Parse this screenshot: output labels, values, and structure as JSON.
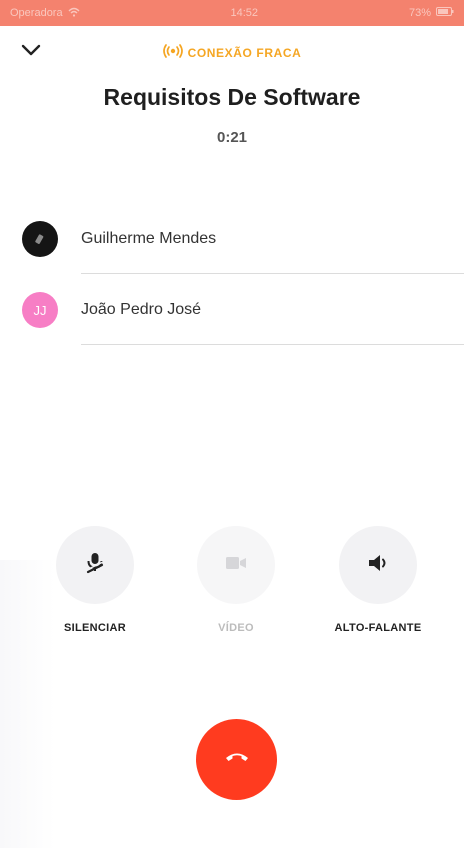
{
  "status_bar": {
    "carrier": "Operadora",
    "time": "14:52",
    "battery": "73%",
    "bg_color": "#f4826e"
  },
  "header": {
    "collapse_icon": "chevron-down-icon",
    "connection_warning": "CONEXÃO FRACA",
    "warning_icon": "broadcast-icon",
    "warning_color": "#f5a623"
  },
  "call": {
    "title": "Requisitos De Software",
    "duration": "0:21"
  },
  "participants": [
    {
      "name": "Guilherme Mendes",
      "initials": "",
      "avatar_color": "#151515"
    },
    {
      "name": "João Pedro José",
      "initials": "JJ",
      "avatar_color": "#f77ec5"
    }
  ],
  "controls": {
    "mute": {
      "label": "SILENCIAR",
      "icon": "microphone-off-icon"
    },
    "video": {
      "label": "VÍDEO",
      "icon": "video-camera-icon",
      "enabled": false
    },
    "speaker": {
      "label": "ALTO-FALANTE",
      "icon": "speaker-icon"
    }
  },
  "end_call": {
    "icon": "phone-hangup-icon",
    "color": "#ff3b1f"
  }
}
